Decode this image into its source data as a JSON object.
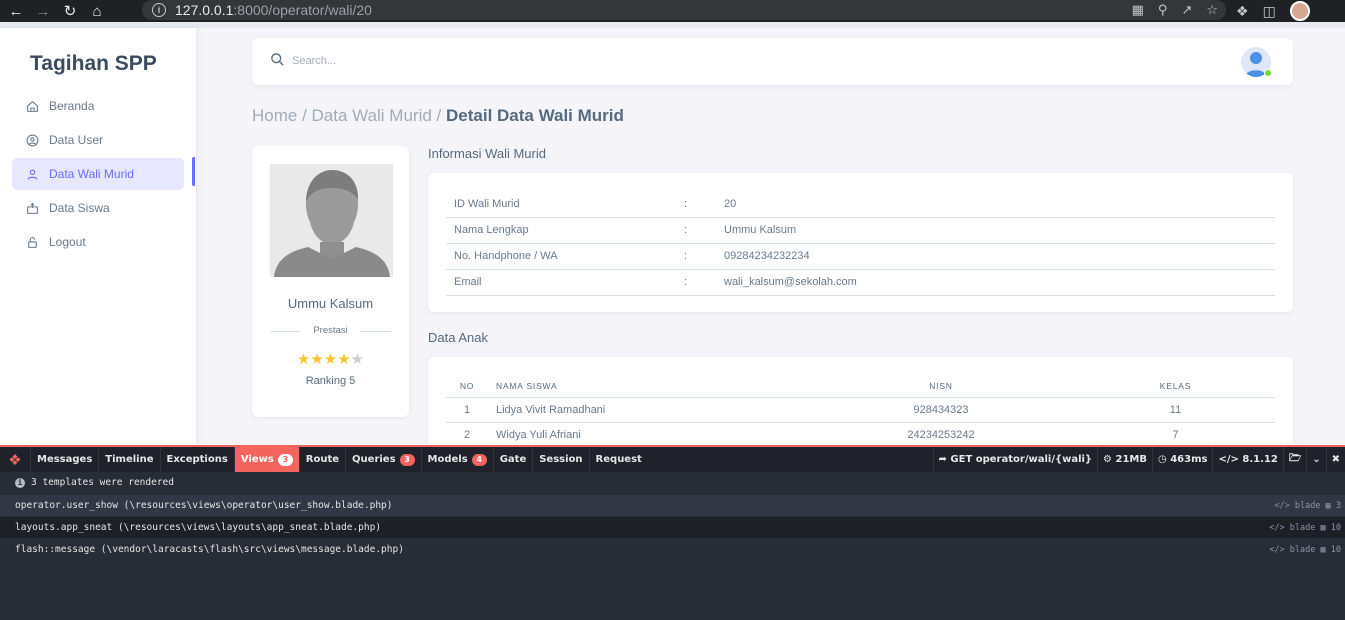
{
  "browser": {
    "url_host": "127.0.0.1",
    "url_path": ":8000/operator/wali/20"
  },
  "sidebar": {
    "brand": "Tagihan SPP",
    "items": [
      {
        "label": "Beranda",
        "icon": "home-icon"
      },
      {
        "label": "Data User",
        "icon": "user-circle-icon"
      },
      {
        "label": "Data Wali Murid",
        "icon": "user-icon",
        "active": true
      },
      {
        "label": "Data Siswa",
        "icon": "id-card-icon"
      },
      {
        "label": "Logout",
        "icon": "lock-icon"
      }
    ]
  },
  "navbar": {
    "search_placeholder": "Search..."
  },
  "breadcrumb": {
    "home": "Home",
    "sep": " / ",
    "parent": "Data Wali Murid",
    "current": "Detail Data Wali Murid"
  },
  "profile": {
    "name": "Ummu Kalsum",
    "prestasi_label": "Prestasi",
    "rating": 4,
    "rating_max": 5,
    "ranking": "Ranking 5"
  },
  "info": {
    "title": "Informasi Wali Murid",
    "colon": ":",
    "rows": [
      {
        "label": "ID Wali Murid",
        "value": "20"
      },
      {
        "label": "Nama Lengkap",
        "value": "Ummu Kalsum"
      },
      {
        "label": "No. Handphone / WA",
        "value": "09284234232234"
      },
      {
        "label": "Email",
        "value": "wali_kalsum@sekolah.com"
      }
    ]
  },
  "anak": {
    "title": "Data Anak",
    "headers": [
      "NO",
      "NAMA SISWA",
      "NISN",
      "KELAS"
    ],
    "rows": [
      [
        "1",
        "Lidya Vivit Ramadhani",
        "928434323",
        "11"
      ],
      [
        "2",
        "Widya Yuli Afriani",
        "24234253242",
        "7"
      ]
    ]
  },
  "debugbar": {
    "tabs": [
      {
        "label": "Messages"
      },
      {
        "label": "Timeline"
      },
      {
        "label": "Exceptions"
      },
      {
        "label": "Views",
        "badge": "3",
        "active": true
      },
      {
        "label": "Route"
      },
      {
        "label": "Queries",
        "badge": "3"
      },
      {
        "label": "Models",
        "badge": "4"
      },
      {
        "label": "Gate"
      },
      {
        "label": "Session"
      },
      {
        "label": "Request"
      }
    ],
    "route": "GET operator/wali/{wali}",
    "memory": "21MB",
    "time": "463ms",
    "php_version": "8.1.12",
    "summary": "3 templates were rendered",
    "templates": [
      {
        "name": "operator.user_show (\\resources\\views\\operator\\user_show.blade.php)",
        "type": "blade",
        "params": "3"
      },
      {
        "name": "layouts.app_sneat (\\resources\\views\\layouts\\app_sneat.blade.php)",
        "type": "blade",
        "params": "10"
      },
      {
        "name": "flash::message (\\vendor\\laracasts\\flash\\src\\views\\message.blade.php)",
        "type": "blade",
        "params": "10"
      }
    ]
  }
}
